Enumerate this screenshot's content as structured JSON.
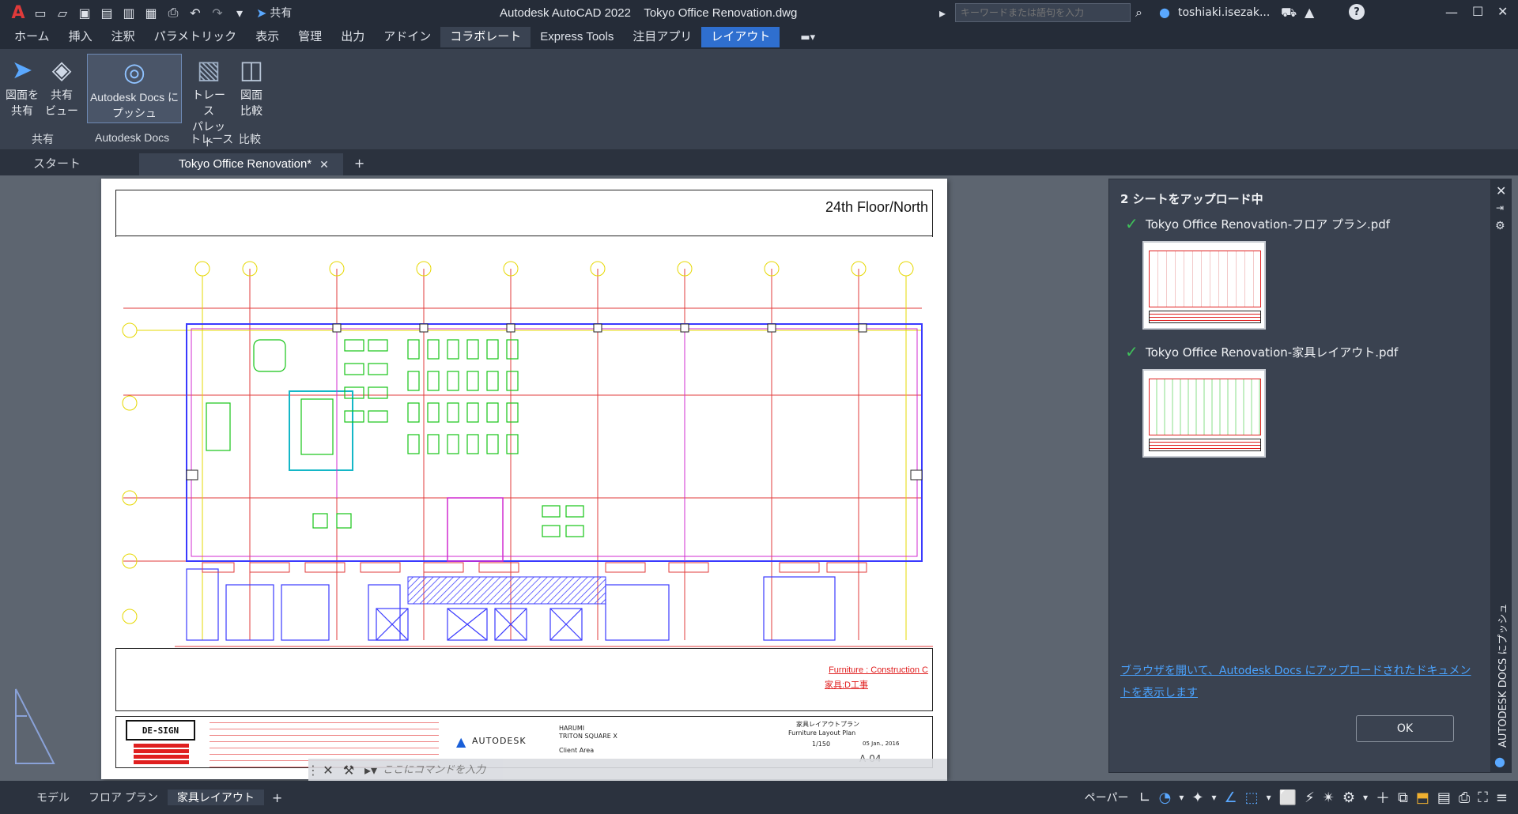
{
  "titlebar": {
    "app_menu": "A",
    "share_label": "共有",
    "title": "Autodesk AutoCAD 2022    Tokyo Office Renovation.dwg",
    "search_placeholder": "キーワードまたは語句を入力",
    "user": "toshiaki.isezak...",
    "help": "?"
  },
  "ribbon_tabs": [
    "ホーム",
    "挿入",
    "注釈",
    "パラメトリック",
    "表示",
    "管理",
    "出力",
    "アドイン",
    "コラボレート",
    "Express Tools",
    "注目アプリ",
    "レイアウト"
  ],
  "ribbon": {
    "tools": [
      {
        "label1": "図面を",
        "label2": "共有"
      },
      {
        "label1": "共有",
        "label2": "ビュー"
      },
      {
        "label1": "Autodesk Docs に",
        "label2": "プッシュ"
      },
      {
        "label1": "トレース",
        "label2": "パレット"
      },
      {
        "label1": "図面",
        "label2": "比較"
      }
    ],
    "groups": [
      "共有",
      "Autodesk Docs",
      "トレース",
      "比較"
    ]
  },
  "doc_tabs": {
    "start": "スタート",
    "active": "Tokyo Office Renovation*"
  },
  "drawing": {
    "header": "24th Floor/North",
    "stamp1": "Furniture : Construction C",
    "stamp2": "家具:D工事",
    "logo": "DE-SIGN",
    "autodesk_logo": "AUTODESK",
    "project1": "HARUMI",
    "project2": "TRITON SQUARE X",
    "client": "Client Area",
    "sheet_title1": "家具レイアウトプラン",
    "sheet_title2": "Furniture Layout Plan",
    "scale": "1/150",
    "date": "05 Jan., 2016",
    "sheet_no": "A-04"
  },
  "command_line": {
    "placeholder": "ここにコマンドを入力"
  },
  "upload_panel": {
    "title": "2 シートをアップロード中",
    "files": [
      "Tokyo Office Renovation-フロア プラン.pdf",
      "Tokyo Office Renovation-家具レイアウト.pdf"
    ],
    "link": "ブラウザを開いて、Autodesk Docs にアップロードされたドキュメントを表示します",
    "ok": "OK",
    "side_title": "AUTODESK DOCS にプッシュ"
  },
  "layout_tabs": [
    "モデル",
    "フロア プラン",
    "家具レイアウト"
  ],
  "status": {
    "paper": "ペーパー"
  },
  "colors": {
    "accent": "#2f6fcf",
    "panel": "#3a4250",
    "bg": "#5d6570"
  }
}
